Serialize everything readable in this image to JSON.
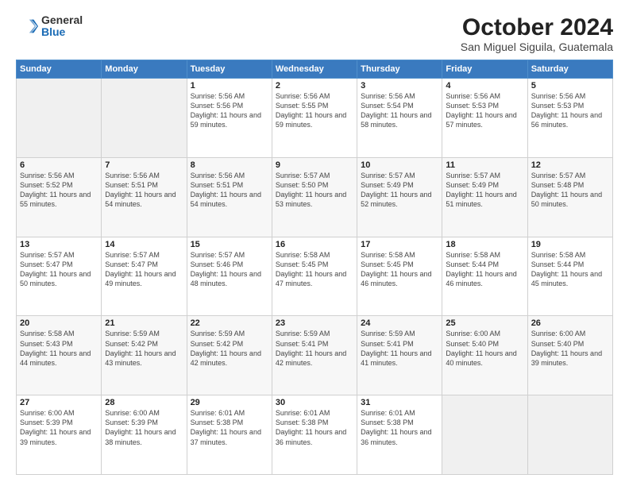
{
  "header": {
    "logo_general": "General",
    "logo_blue": "Blue",
    "month_title": "October 2024",
    "location": "San Miguel Siguila, Guatemala"
  },
  "weekdays": [
    "Sunday",
    "Monday",
    "Tuesday",
    "Wednesday",
    "Thursday",
    "Friday",
    "Saturday"
  ],
  "weeks": [
    [
      {
        "day": "",
        "empty": true
      },
      {
        "day": "",
        "empty": true
      },
      {
        "day": "1",
        "sunrise": "5:56 AM",
        "sunset": "5:56 PM",
        "daylight": "11 hours and 59 minutes."
      },
      {
        "day": "2",
        "sunrise": "5:56 AM",
        "sunset": "5:55 PM",
        "daylight": "11 hours and 59 minutes."
      },
      {
        "day": "3",
        "sunrise": "5:56 AM",
        "sunset": "5:54 PM",
        "daylight": "11 hours and 58 minutes."
      },
      {
        "day": "4",
        "sunrise": "5:56 AM",
        "sunset": "5:53 PM",
        "daylight": "11 hours and 57 minutes."
      },
      {
        "day": "5",
        "sunrise": "5:56 AM",
        "sunset": "5:53 PM",
        "daylight": "11 hours and 56 minutes."
      }
    ],
    [
      {
        "day": "6",
        "sunrise": "5:56 AM",
        "sunset": "5:52 PM",
        "daylight": "11 hours and 55 minutes."
      },
      {
        "day": "7",
        "sunrise": "5:56 AM",
        "sunset": "5:51 PM",
        "daylight": "11 hours and 54 minutes."
      },
      {
        "day": "8",
        "sunrise": "5:56 AM",
        "sunset": "5:51 PM",
        "daylight": "11 hours and 54 minutes."
      },
      {
        "day": "9",
        "sunrise": "5:57 AM",
        "sunset": "5:50 PM",
        "daylight": "11 hours and 53 minutes."
      },
      {
        "day": "10",
        "sunrise": "5:57 AM",
        "sunset": "5:49 PM",
        "daylight": "11 hours and 52 minutes."
      },
      {
        "day": "11",
        "sunrise": "5:57 AM",
        "sunset": "5:49 PM",
        "daylight": "11 hours and 51 minutes."
      },
      {
        "day": "12",
        "sunrise": "5:57 AM",
        "sunset": "5:48 PM",
        "daylight": "11 hours and 50 minutes."
      }
    ],
    [
      {
        "day": "13",
        "sunrise": "5:57 AM",
        "sunset": "5:47 PM",
        "daylight": "11 hours and 50 minutes."
      },
      {
        "day": "14",
        "sunrise": "5:57 AM",
        "sunset": "5:47 PM",
        "daylight": "11 hours and 49 minutes."
      },
      {
        "day": "15",
        "sunrise": "5:57 AM",
        "sunset": "5:46 PM",
        "daylight": "11 hours and 48 minutes."
      },
      {
        "day": "16",
        "sunrise": "5:58 AM",
        "sunset": "5:45 PM",
        "daylight": "11 hours and 47 minutes."
      },
      {
        "day": "17",
        "sunrise": "5:58 AM",
        "sunset": "5:45 PM",
        "daylight": "11 hours and 46 minutes."
      },
      {
        "day": "18",
        "sunrise": "5:58 AM",
        "sunset": "5:44 PM",
        "daylight": "11 hours and 46 minutes."
      },
      {
        "day": "19",
        "sunrise": "5:58 AM",
        "sunset": "5:44 PM",
        "daylight": "11 hours and 45 minutes."
      }
    ],
    [
      {
        "day": "20",
        "sunrise": "5:58 AM",
        "sunset": "5:43 PM",
        "daylight": "11 hours and 44 minutes."
      },
      {
        "day": "21",
        "sunrise": "5:59 AM",
        "sunset": "5:42 PM",
        "daylight": "11 hours and 43 minutes."
      },
      {
        "day": "22",
        "sunrise": "5:59 AM",
        "sunset": "5:42 PM",
        "daylight": "11 hours and 42 minutes."
      },
      {
        "day": "23",
        "sunrise": "5:59 AM",
        "sunset": "5:41 PM",
        "daylight": "11 hours and 42 minutes."
      },
      {
        "day": "24",
        "sunrise": "5:59 AM",
        "sunset": "5:41 PM",
        "daylight": "11 hours and 41 minutes."
      },
      {
        "day": "25",
        "sunrise": "6:00 AM",
        "sunset": "5:40 PM",
        "daylight": "11 hours and 40 minutes."
      },
      {
        "day": "26",
        "sunrise": "6:00 AM",
        "sunset": "5:40 PM",
        "daylight": "11 hours and 39 minutes."
      }
    ],
    [
      {
        "day": "27",
        "sunrise": "6:00 AM",
        "sunset": "5:39 PM",
        "daylight": "11 hours and 39 minutes."
      },
      {
        "day": "28",
        "sunrise": "6:00 AM",
        "sunset": "5:39 PM",
        "daylight": "11 hours and 38 minutes."
      },
      {
        "day": "29",
        "sunrise": "6:01 AM",
        "sunset": "5:38 PM",
        "daylight": "11 hours and 37 minutes."
      },
      {
        "day": "30",
        "sunrise": "6:01 AM",
        "sunset": "5:38 PM",
        "daylight": "11 hours and 36 minutes."
      },
      {
        "day": "31",
        "sunrise": "6:01 AM",
        "sunset": "5:38 PM",
        "daylight": "11 hours and 36 minutes."
      },
      {
        "day": "",
        "empty": true
      },
      {
        "day": "",
        "empty": true
      }
    ]
  ]
}
